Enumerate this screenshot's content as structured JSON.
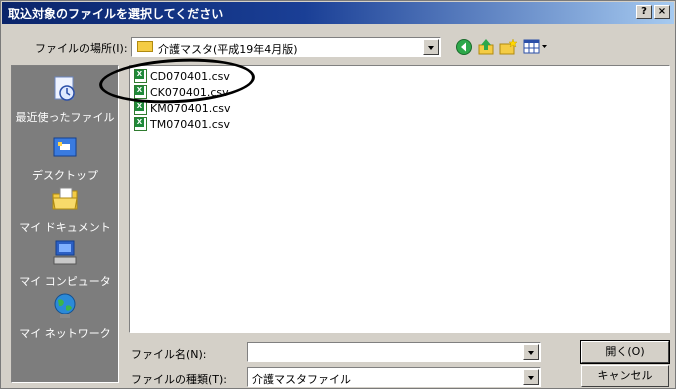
{
  "dialog": {
    "title": "取込対象のファイルを選択してください",
    "help_label": "?",
    "close_label": "×"
  },
  "lookin": {
    "label": "ファイルの場所(I):",
    "value": "介護マスタ(平成19年4月版)"
  },
  "places": [
    {
      "label": "最近使ったファイル",
      "icon": "recent-icon"
    },
    {
      "label": "デスクトップ",
      "icon": "desktop-icon"
    },
    {
      "label": "マイ ドキュメント",
      "icon": "my-documents-icon"
    },
    {
      "label": "マイ コンピュータ",
      "icon": "my-computer-icon"
    },
    {
      "label": "マイ ネットワーク",
      "icon": "my-network-icon"
    }
  ],
  "files": [
    {
      "name": "CD070401.csv"
    },
    {
      "name": "CK070401.csv"
    },
    {
      "name": "KM070401.csv"
    },
    {
      "name": "TM070401.csv"
    }
  ],
  "filename": {
    "label": "ファイル名(N):",
    "value": ""
  },
  "filetype": {
    "label": "ファイルの種類(T):",
    "value": "介護マスタファイル"
  },
  "buttons": {
    "open": "開く(O)",
    "cancel": "キャンセル"
  },
  "colors": {
    "title_start": "#0a246a",
    "title_end": "#a6caf0",
    "dialog_bg": "#d4d0c8",
    "places_bg": "#7d7d7d"
  }
}
